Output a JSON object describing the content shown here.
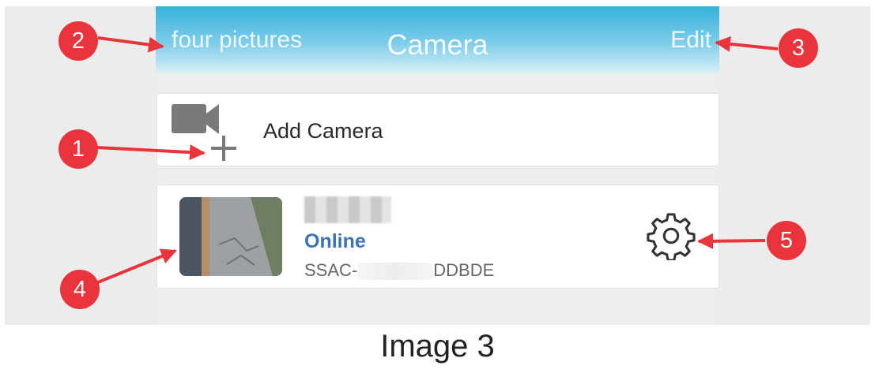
{
  "header": {
    "left_label": "four pictures",
    "title": "Camera",
    "right_label": "Edit"
  },
  "add_camera": {
    "label": "Add Camera",
    "icon": "video-camera-plus-icon"
  },
  "camera": {
    "status": "Online",
    "uid_prefix": "SSAC-",
    "uid_suffix": "DDBDE",
    "settings_icon": "gear-icon"
  },
  "callouts": [
    "1",
    "2",
    "3",
    "4",
    "5"
  ],
  "caption": "Image 3",
  "colors": {
    "header_top": "#36b1dc",
    "callout": "#e8343a",
    "online": "#3c72b6"
  }
}
